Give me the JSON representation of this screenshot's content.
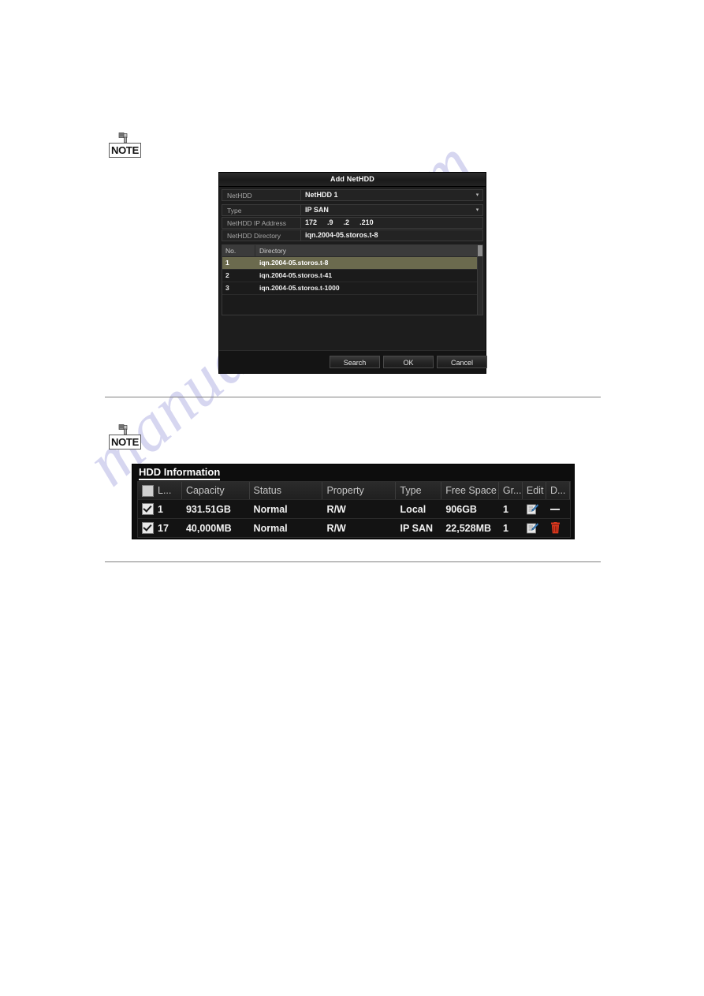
{
  "page": {
    "watermark_text": "manualshive.com",
    "note_label": "NOTE"
  },
  "dialog": {
    "title": "Add NetHDD",
    "fields": [
      {
        "label": "NetHDD",
        "value": "NetHDD 1",
        "type": "dropdown"
      },
      {
        "label": "Type",
        "value": "IP SAN",
        "type": "dropdown"
      },
      {
        "label": "NetHDD IP Address",
        "value": "172 .9    .2    .210",
        "type": "ip"
      },
      {
        "label": "NetHDD Directory",
        "value": "iqn.2004-05.storos.t-8",
        "type": "text"
      }
    ],
    "ip_segments": [
      "172",
      ".9",
      ".2",
      ".210"
    ],
    "list": {
      "columns": [
        "No.",
        "Directory"
      ],
      "rows": [
        {
          "no": "1",
          "directory": "iqn.2004-05.storos.t-8",
          "selected": true
        },
        {
          "no": "2",
          "directory": "iqn.2004-05.storos.t-41",
          "selected": false
        },
        {
          "no": "3",
          "directory": "iqn.2004-05.storos.t-1000",
          "selected": false
        }
      ]
    },
    "buttons": {
      "search": "Search",
      "ok": "OK",
      "cancel": "Cancel"
    }
  },
  "hdd_info": {
    "title": "HDD Information",
    "columns": {
      "label": "L...",
      "capacity": "Capacity",
      "status": "Status",
      "property": "Property",
      "type": "Type",
      "free_space": "Free Space",
      "group": "Gr...",
      "edit": "Edit",
      "delete": "D..."
    },
    "rows": [
      {
        "checked": true,
        "index": "1",
        "capacity": "931.51GB",
        "status": "Normal",
        "property": "R/W",
        "type": "Local",
        "free_space": "906GB",
        "group": "1",
        "edit_icon": "edit-pencil-icon",
        "delete_icon": "dash-icon"
      },
      {
        "checked": true,
        "index": "17",
        "capacity": "40,000MB",
        "status": "Normal",
        "property": "R/W",
        "type": "IP SAN",
        "free_space": "22,528MB",
        "group": "1",
        "edit_icon": "edit-pencil-icon",
        "delete_icon": "trash-icon"
      }
    ]
  },
  "colors": {
    "dialog_bg": "#1d1d1d",
    "selection": "#6b6a4e",
    "panel_bg": "#0d0d0d",
    "trash_red": "#d9381e",
    "watermark": "#c9c9ec"
  }
}
